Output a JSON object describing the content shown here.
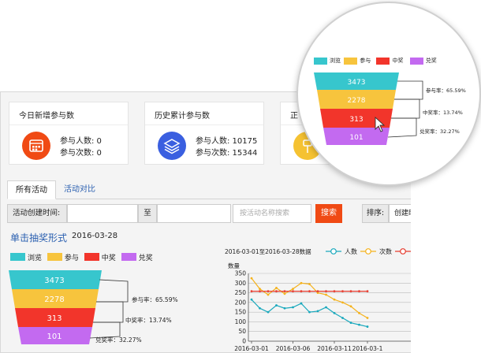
{
  "cards": [
    {
      "title": "今日新增参与数",
      "lines": [
        "参与人数: 0",
        "参与次数: 0"
      ],
      "icon": "calendar-icon",
      "color": "#f04a14"
    },
    {
      "title": "历史累计参与数",
      "lines": [
        "参与人数: 10175",
        "参与次数: 15344"
      ],
      "icon": "layers-icon",
      "color": "#3a5fe0"
    },
    {
      "title": "正",
      "lines": [],
      "icon": "pin-icon",
      "color": "#f5c232"
    }
  ],
  "tabs": [
    "所有活动",
    "活动对比"
  ],
  "filter": {
    "created_label": "活动创建时间:",
    "to_label": "至",
    "search_placeholder": "按活动名称搜索",
    "search_button": "搜索",
    "sort_label": "排序:",
    "sort_value": "创建时"
  },
  "section": {
    "title": "单击抽奖形式",
    "date": "2016-03-28"
  },
  "funnel": {
    "legend": [
      {
        "label": "浏览",
        "color": "#37c6cd"
      },
      {
        "label": "参与",
        "color": "#f7c43d"
      },
      {
        "label": "中奖",
        "color": "#f2352b"
      },
      {
        "label": "兑奖",
        "color": "#c36af0"
      }
    ],
    "values": [
      3473,
      2278,
      313,
      101
    ],
    "rates": [
      "参与率：65.59%",
      "中奖率：13.74%",
      "兑奖率：32.27%"
    ]
  },
  "chart_data": {
    "type": "line",
    "title": "2016-03-01至2016-03-28数据",
    "ylabel": "数量",
    "ylim": [
      0,
      350
    ],
    "yticks": [
      0,
      50,
      100,
      150,
      200,
      250,
      300,
      350
    ],
    "x": [
      "2016-03-01",
      "2016-03-02",
      "2016-03-03",
      "2016-03-04",
      "2016-03-05",
      "2016-03-06",
      "2016-03-07",
      "2016-03-08",
      "2016-03-09",
      "2016-03-10",
      "2016-03-11",
      "2016-03-12",
      "2016-03-13",
      "2016-03-14",
      "2016-03-15"
    ],
    "xticks": [
      "2016-03-01",
      "2016-03-06",
      "2016-03-11",
      "2016-03-1"
    ],
    "series": [
      {
        "name": "人数",
        "color": "#1aa9bd",
        "values": [
          215,
          170,
          150,
          185,
          170,
          175,
          195,
          150,
          155,
          175,
          145,
          120,
          95,
          85,
          75
        ]
      },
      {
        "name": "次数",
        "color": "#f5b21c",
        "values": [
          325,
          270,
          240,
          275,
          245,
          270,
          300,
          295,
          250,
          240,
          215,
          200,
          180,
          145,
          120
        ]
      },
      {
        "name": "",
        "color": "#e63c2f",
        "values": [
          258,
          258,
          258,
          258,
          258,
          258,
          258,
          258,
          258,
          258,
          258,
          258,
          258,
          258,
          258
        ]
      }
    ]
  }
}
